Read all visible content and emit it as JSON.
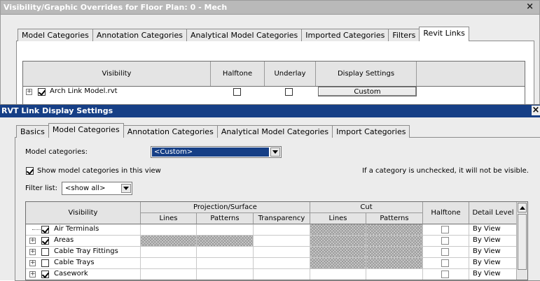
{
  "back_window": {
    "title": "Visibility/Graphic Overrides for Floor Plan: 0 - Mech",
    "close": "×",
    "tabs": [
      "Model Categories",
      "Annotation Categories",
      "Analytical Model Categories",
      "Imported Categories",
      "Filters",
      "Revit Links"
    ],
    "active_tab": "Revit Links",
    "grid": {
      "columns": [
        "Visibility",
        "Halftone",
        "Underlay",
        "Display Settings"
      ],
      "rows": [
        {
          "name": "Arch Link Model.rvt",
          "visible": true,
          "halftone": false,
          "underlay": false,
          "display_settings": "Custom"
        }
      ]
    }
  },
  "front_window": {
    "title": "RVT Link Display Settings",
    "close": "×",
    "tabs": [
      "Basics",
      "Model Categories",
      "Annotation Categories",
      "Analytical Model Categories",
      "Import Categories"
    ],
    "active_tab": "Model Categories",
    "model_categories_label": "Model categories:",
    "model_categories_value": "<Custom>",
    "show_in_view_label": "Show model categories in this view",
    "show_in_view_checked": true,
    "unchecked_note": "If a category is unchecked, it will not be visible.",
    "filter_label": "Filter list:",
    "filter_value": "<show all>",
    "grid": {
      "visibility_header": "Visibility",
      "group_projection": "Projection/Surface",
      "group_cut": "Cut",
      "sub_headers": [
        "Lines",
        "Patterns",
        "Transparency",
        "Lines",
        "Patterns"
      ],
      "halftone_header": "Halftone",
      "detail_header": "Detail Level",
      "rows": [
        {
          "name": "Air Terminals",
          "expandable": false,
          "checked": true,
          "detail": "By View",
          "hatch": [
            false,
            false,
            false,
            true,
            true
          ]
        },
        {
          "name": "Areas",
          "expandable": true,
          "checked": true,
          "detail": "By View",
          "hatch": [
            true,
            true,
            false,
            true,
            true
          ]
        },
        {
          "name": "Cable Tray Fittings",
          "expandable": true,
          "checked": false,
          "detail": "By View",
          "hatch": [
            false,
            false,
            false,
            true,
            true
          ]
        },
        {
          "name": "Cable Trays",
          "expandable": true,
          "checked": false,
          "detail": "By View",
          "hatch": [
            false,
            false,
            false,
            true,
            true
          ]
        },
        {
          "name": "Casework",
          "expandable": true,
          "checked": true,
          "detail": "By View",
          "hatch": [
            false,
            false,
            false,
            false,
            false
          ]
        }
      ]
    }
  }
}
